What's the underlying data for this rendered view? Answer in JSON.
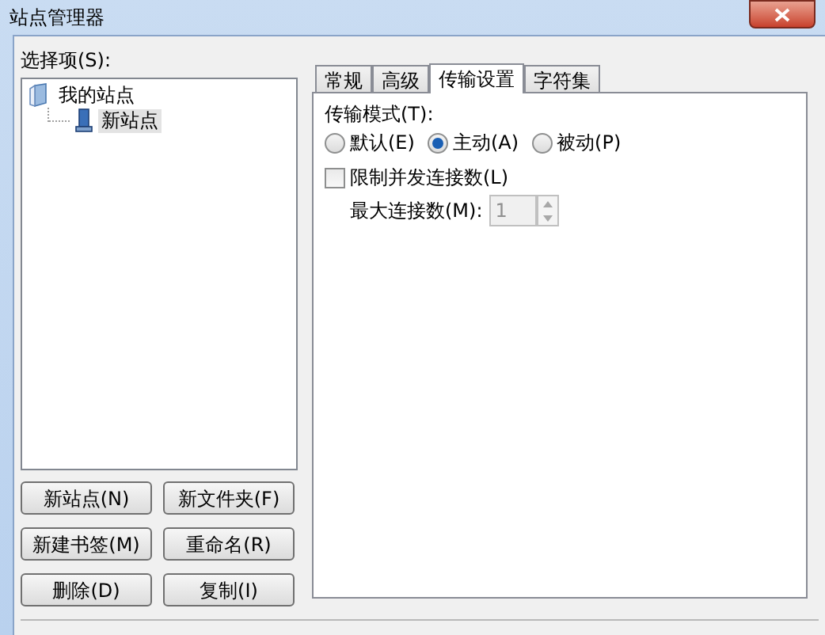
{
  "window": {
    "title": "站点管理器"
  },
  "selection_label": "选择项(S):",
  "tree": [
    {
      "label": "我的站点",
      "selected": false,
      "children": [
        {
          "label": "新站点",
          "selected": true
        }
      ]
    }
  ],
  "buttons": [
    "新站点(N)",
    "新文件夹(F)",
    "新建书签(M)",
    "重命名(R)",
    "删除(D)",
    "复制(I)"
  ],
  "tabs": [
    {
      "label": "常规",
      "selected": false
    },
    {
      "label": "高级",
      "selected": false
    },
    {
      "label": "传输设置",
      "selected": true
    },
    {
      "label": "字符集",
      "selected": false
    }
  ],
  "transfer": {
    "mode_label": "传输模式(T):",
    "modes": [
      {
        "label": "默认(E)",
        "selected": false
      },
      {
        "label": "主动(A)",
        "selected": true
      },
      {
        "label": "被动(P)",
        "selected": false
      }
    ],
    "limit": {
      "label": "限制并发连接数(L)",
      "checked": false
    },
    "max": {
      "label": "最大连接数(M):",
      "value": "1",
      "disabled": true
    }
  }
}
